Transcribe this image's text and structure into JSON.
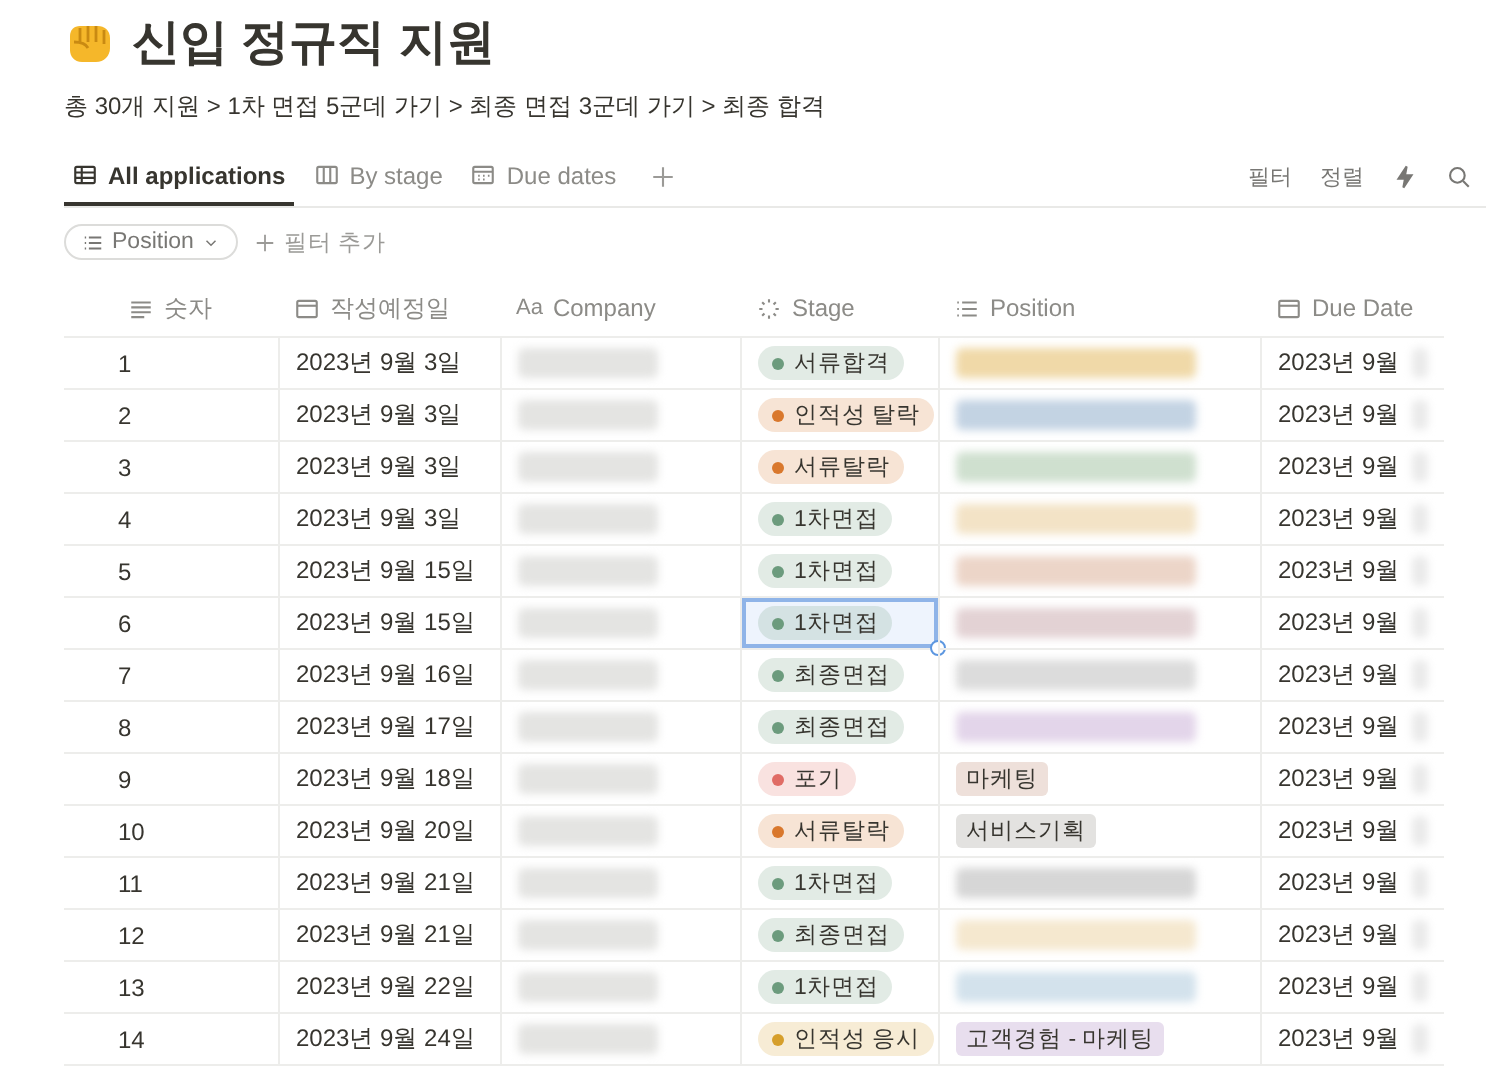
{
  "page": {
    "title": "신입 정규직 지원",
    "subtitle": "총 30개 지원 > 1차 면접 5군데 가기 > 최종 면접 3군데 가기 > 최종 합격"
  },
  "tabs": [
    {
      "label": "All applications",
      "kind": "table",
      "selected": true
    },
    {
      "label": "By stage",
      "kind": "board",
      "selected": false
    },
    {
      "label": "Due dates",
      "kind": "calendar",
      "selected": false
    }
  ],
  "toolbar": {
    "filter": "필터",
    "sort": "정렬"
  },
  "filters": {
    "chip": "Position",
    "add": "필터 추가"
  },
  "columns": [
    {
      "label": "숫자",
      "kind": "number"
    },
    {
      "label": "작성예정일",
      "kind": "date"
    },
    {
      "label": "Company",
      "kind": "title",
      "icon_text": "Aa"
    },
    {
      "label": "Stage",
      "kind": "status"
    },
    {
      "label": "Position",
      "kind": "multi"
    },
    {
      "label": "Due Date",
      "kind": "date"
    }
  ],
  "rows": [
    {
      "no": "1",
      "date": "2023년 9월 3일",
      "stage": {
        "label": "서류합격",
        "color": "#6c9b7d"
      },
      "position": {
        "kind": "blurred",
        "color": "#f0d9a8"
      },
      "due": "2023년 9월",
      "selected": false
    },
    {
      "no": "2",
      "date": "2023년 9월 3일",
      "stage": {
        "label": "인적성 탈락",
        "color": "#d9782d"
      },
      "position": {
        "kind": "blurred",
        "color": "#c3d3e3"
      },
      "due": "2023년 9월",
      "selected": false
    },
    {
      "no": "3",
      "date": "2023년 9월 3일",
      "stage": {
        "label": "서류탈락",
        "color": "#d9782d"
      },
      "position": {
        "kind": "blurred",
        "color": "#cfe0cf"
      },
      "due": "2023년 9월",
      "selected": false
    },
    {
      "no": "4",
      "date": "2023년 9월 3일",
      "stage": {
        "label": "1차면접",
        "color": "#6c9b7d"
      },
      "position": {
        "kind": "blurred",
        "color": "#f3e3c6"
      },
      "due": "2023년 9월",
      "selected": false
    },
    {
      "no": "5",
      "date": "2023년 9월 15일",
      "stage": {
        "label": "1차면접",
        "color": "#6c9b7d"
      },
      "position": {
        "kind": "blurred",
        "color": "#ecd5c8"
      },
      "due": "2023년 9월",
      "selected": false
    },
    {
      "no": "6",
      "date": "2023년 9월 15일",
      "stage": {
        "label": "1차면접",
        "color": "#6c9b7d"
      },
      "position": {
        "kind": "blurred",
        "color": "#e3d2d4"
      },
      "due": "2023년 9월",
      "selected": true
    },
    {
      "no": "7",
      "date": "2023년 9월 16일",
      "stage": {
        "label": "최종면접",
        "color": "#6c9b7d"
      },
      "position": {
        "kind": "blurred",
        "color": "#dcdcdc"
      },
      "due": "2023년 9월",
      "selected": false
    },
    {
      "no": "8",
      "date": "2023년 9월 17일",
      "stage": {
        "label": "최종면접",
        "color": "#6c9b7d"
      },
      "position": {
        "kind": "blurred",
        "color": "#e3d5ea"
      },
      "due": "2023년 9월",
      "selected": false
    },
    {
      "no": "9",
      "date": "2023년 9월 18일",
      "stage": {
        "label": "포기",
        "color": "#e06c65"
      },
      "position": {
        "kind": "tag",
        "label": "마케팅",
        "color": "#eee0da"
      },
      "due": "2023년 9월",
      "selected": false
    },
    {
      "no": "10",
      "date": "2023년 9월 20일",
      "stage": {
        "label": "서류탈락",
        "color": "#d9782d"
      },
      "position": {
        "kind": "tag",
        "label": "서비스기획",
        "color": "#e3e2e0"
      },
      "due": "2023년 9월",
      "selected": false
    },
    {
      "no": "11",
      "date": "2023년 9월 21일",
      "stage": {
        "label": "1차면접",
        "color": "#6c9b7d"
      },
      "position": {
        "kind": "blurred",
        "color": "#d6d6d6"
      },
      "due": "2023년 9월",
      "selected": false
    },
    {
      "no": "12",
      "date": "2023년 9월 21일",
      "stage": {
        "label": "최종면접",
        "color": "#6c9b7d"
      },
      "position": {
        "kind": "blurred",
        "color": "#f5e8cf"
      },
      "due": "2023년 9월",
      "selected": false
    },
    {
      "no": "13",
      "date": "2023년 9월 22일",
      "stage": {
        "label": "1차면접",
        "color": "#6c9b7d"
      },
      "position": {
        "kind": "blurred",
        "color": "#d3e2ec"
      },
      "due": "2023년 9월",
      "selected": false
    },
    {
      "no": "14",
      "date": "2023년 9월 24일",
      "stage": {
        "label": "인적성 응시",
        "color": "#d69f2b"
      },
      "position": {
        "kind": "tag",
        "label": "고객경험 - 마케팅",
        "color": "#e8deee"
      },
      "due": "2023년 9월",
      "selected": false
    }
  ]
}
